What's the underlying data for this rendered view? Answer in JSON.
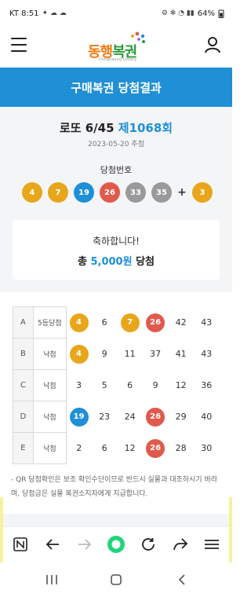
{
  "status": {
    "carrier_time": "KT 8:51",
    "battery": "64%"
  },
  "header": {
    "logo_text_a": "동행",
    "logo_text_b": "복권",
    "logo_sub": "Donghaeng Lottery"
  },
  "hero_title": "구매복권 당첨결과",
  "draw": {
    "game": "로또 6/45 ",
    "round": "제1068회",
    "date": "2023-05-20 추첨",
    "win_label": "당첨번호"
  },
  "winning_numbers": [
    {
      "n": "4",
      "color": "#e8a61b"
    },
    {
      "n": "7",
      "color": "#e8a61b"
    },
    {
      "n": "19",
      "color": "#1f8fd6"
    },
    {
      "n": "26",
      "color": "#e05a4c"
    },
    {
      "n": "33",
      "color": "#9a9a9a"
    },
    {
      "n": "35",
      "color": "#9a9a9a"
    }
  ],
  "bonus_plus": "+",
  "bonus_number": {
    "n": "3",
    "color": "#e8a61b"
  },
  "congrats": {
    "message": "축하합니다!",
    "prefix": "총 ",
    "amount": "5,000원",
    "suffix": " 당첨"
  },
  "ticket_rows": [
    {
      "label": "A",
      "result": "5등당첨",
      "numbers": [
        "4",
        "6",
        "7",
        "26",
        "42",
        "43"
      ],
      "hits": [
        {
          "i": 0,
          "color": "#e8a61b"
        },
        {
          "i": 2,
          "color": "#e8a61b"
        },
        {
          "i": 3,
          "color": "#e05a4c"
        }
      ]
    },
    {
      "label": "B",
      "result": "낙첨",
      "numbers": [
        "4",
        "9",
        "11",
        "37",
        "41",
        "43"
      ],
      "hits": [
        {
          "i": 0,
          "color": "#e8a61b"
        }
      ]
    },
    {
      "label": "C",
      "result": "낙첨",
      "numbers": [
        "3",
        "5",
        "6",
        "9",
        "12",
        "36"
      ],
      "hits": []
    },
    {
      "label": "D",
      "result": "낙첨",
      "numbers": [
        "19",
        "23",
        "24",
        "26",
        "29",
        "40"
      ],
      "hits": [
        {
          "i": 0,
          "color": "#1f8fd6"
        },
        {
          "i": 3,
          "color": "#e05a4c"
        }
      ]
    },
    {
      "label": "E",
      "result": "낙첨",
      "numbers": [
        "2",
        "6",
        "12",
        "26",
        "28",
        "30"
      ],
      "hits": [
        {
          "i": 3,
          "color": "#e05a4c"
        }
      ]
    }
  ],
  "note": "- QR 당첨확인은 보조 확인수단이므로 반드시 실물과 대조하시기 바라며, 당첨금은 실물 복권소지자에게 지급합니다.",
  "browser_icons": [
    "n-home-icon",
    "back-arrow-icon",
    "forward-arrow-icon",
    "green-circle-icon",
    "refresh-icon",
    "share-icon",
    "menu-icon"
  ],
  "system_nav": [
    "recent-apps-icon",
    "home-icon",
    "back-icon"
  ]
}
